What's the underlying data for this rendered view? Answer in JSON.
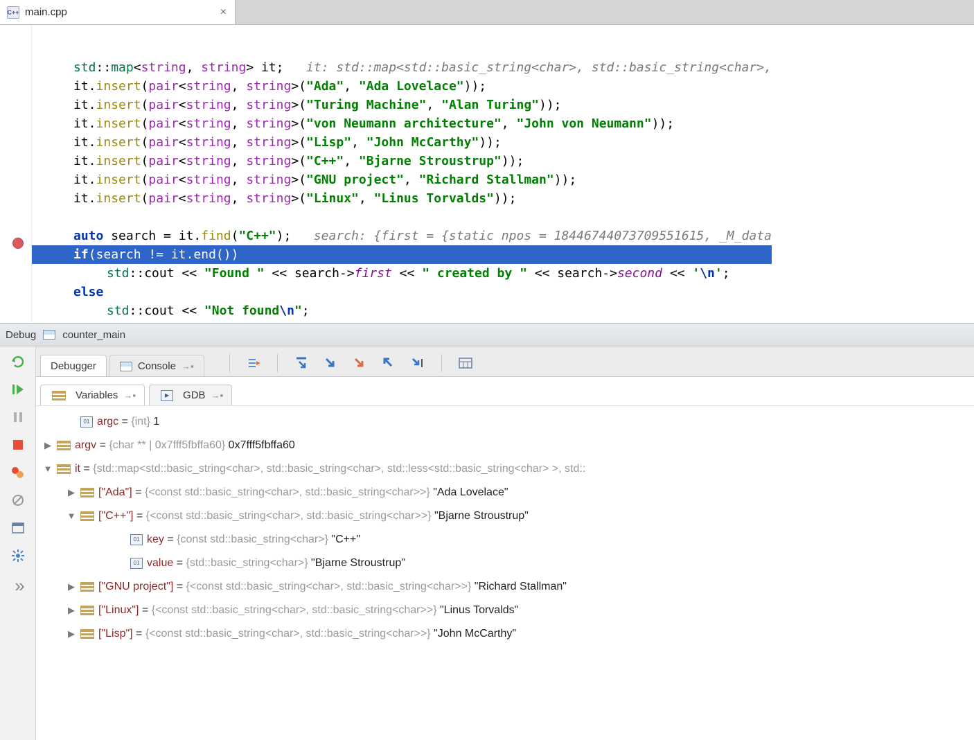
{
  "tab": {
    "filename": "main.cpp"
  },
  "code": {
    "l1": {
      "t1": "std",
      "t2": "::",
      "t3": "map",
      "t4": "<",
      "t5": "string",
      "t6": ", ",
      "t7": "string",
      "t8": "> it;",
      "hint": "it: std::map<std::basic_string<char>, std::basic_string<char>,"
    },
    "insert_prefix": "it.",
    "insert_method": "insert",
    "insert_open": "(",
    "pair": "pair",
    "angle": "<",
    "str": "string",
    "comma": ", ",
    "angle2": ">(",
    "close": "));",
    "pairs": [
      {
        "k": "\"Ada\"",
        "v": "\"Ada Lovelace\""
      },
      {
        "k": "\"Turing Machine\"",
        "v": "\"Alan Turing\""
      },
      {
        "k": "\"von Neumann architecture\"",
        "v": "\"John von Neumann\""
      },
      {
        "k": "\"Lisp\"",
        "v": "\"John McCarthy\""
      },
      {
        "k": "\"C++\"",
        "v": "\"Bjarne Stroustrup\""
      },
      {
        "k": "\"GNU project\"",
        "v": "\"Richard Stallman\""
      },
      {
        "k": "\"Linux\"",
        "v": "\"Linus Torvalds\""
      }
    ],
    "search_line": {
      "auto": "auto",
      "txt1": " search = it.",
      "find": "find",
      "open": "(",
      "arg": "\"C++\"",
      "close": ");",
      "hint": "search: {first = {static npos = 18446744073709551615, _M_data"
    },
    "if_line": {
      "if": "if",
      "rest": "(search != it.",
      "end": "end",
      "rest2": "())"
    },
    "cout1": {
      "std": "std",
      "rest": "::cout << ",
      "s1": "\"Found \"",
      "mid": " << search->",
      "f1": "first",
      "mid2": " << ",
      "s2": "\" created by \"",
      "mid3": " << search->",
      "f2": "second",
      "mid4": " << ",
      "s3": "'",
      "esc": "\\n",
      "s3b": "'",
      ";": ";"
    },
    "else": "else",
    "cout2": {
      "std": "std",
      "rest": "::cout << ",
      "s": "\"Not found",
      "esc": "\\n",
      "s2": "\"",
      ";": ";"
    }
  },
  "debug_strip": {
    "label": "Debug",
    "config": "counter_main"
  },
  "inner_tabs": {
    "debugger": "Debugger",
    "console": "Console"
  },
  "subtabs": {
    "variables": "Variables",
    "gdb": "GDB"
  },
  "vars": {
    "argc": {
      "name": "argc",
      "type": "{int}",
      "val": "1"
    },
    "argv": {
      "name": "argv",
      "type": "{char ** | 0x7fff5fbffa60}",
      "val": "0x7fff5fbffa60"
    },
    "it": {
      "name": "it",
      "type": "{std::map<std::basic_string<char>, std::basic_string<char>, std::less<std::basic_string<char> >, std::"
    },
    "entries": [
      {
        "key": "[\"Ada\"]",
        "type": "{<const std::basic_string<char>, std::basic_string<char>>}",
        "val": "\"Ada Lovelace\"",
        "arrow": "right"
      },
      {
        "key": "[\"C++\"]",
        "type": "{<const std::basic_string<char>, std::basic_string<char>>}",
        "val": "\"Bjarne Stroustrup\"",
        "arrow": "down"
      },
      {
        "key": "[\"GNU project\"]",
        "type": "{<const std::basic_string<char>, std::basic_string<char>>}",
        "val": "\"Richard Stallman\"",
        "arrow": "right"
      },
      {
        "key": "[\"Linux\"]",
        "type": "{<const std::basic_string<char>, std::basic_string<char>>}",
        "val": "\"Linus Torvalds\"",
        "arrow": "right"
      },
      {
        "key": "[\"Lisp\"]",
        "type": "{<const std::basic_string<char>, std::basic_string<char>>}",
        "val": "\"John McCarthy\"",
        "arrow": "right"
      }
    ],
    "cpp_inner": {
      "key": {
        "name": "key",
        "type": "{const std::basic_string<char>}",
        "val": "\"C++\""
      },
      "value": {
        "name": "value",
        "type": "{std::basic_string<char>}",
        "val": "\"Bjarne Stroustrup\""
      }
    }
  }
}
